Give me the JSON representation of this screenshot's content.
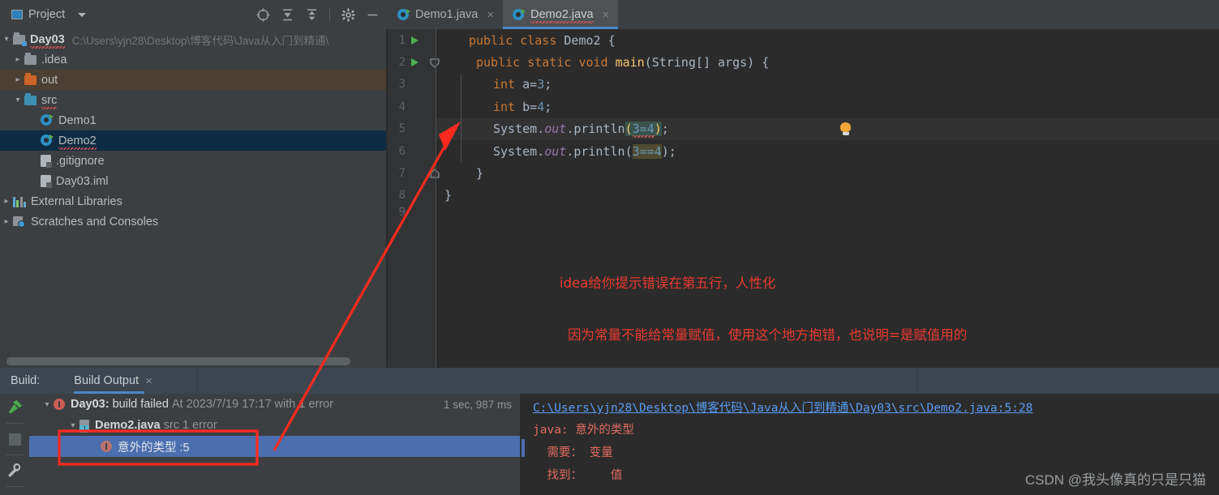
{
  "project_panel": {
    "title": "Project",
    "icons": [
      "window-icon",
      "chevron-down-icon",
      "locate-target-icon",
      "expand-all-icon",
      "collapse-all-icon",
      "gear-icon",
      "minimize-icon"
    ],
    "tree": [
      {
        "label": "Day03",
        "path": "C:\\Users\\yjn28\\Desktop\\博客代码\\Java从入门到精通\\",
        "icon": "folder-module-icon",
        "expanded": true,
        "depth": 0,
        "bold": true
      },
      {
        "label": ".idea",
        "icon": "folder-gray-icon",
        "expanded": false,
        "depth": 1
      },
      {
        "label": "out",
        "icon": "folder-orange-icon",
        "expanded": false,
        "depth": 1,
        "highlight": "excluded"
      },
      {
        "label": "src",
        "icon": "folder-blue-icon",
        "expanded": true,
        "depth": 1
      },
      {
        "label": "Demo1",
        "icon": "java-class-icon",
        "depth": 2
      },
      {
        "label": "Demo2",
        "icon": "java-class-icon",
        "depth": 2,
        "highlight": "selected"
      },
      {
        "label": ".gitignore",
        "icon": "gitignore-file-icon",
        "depth": 1
      },
      {
        "label": "Day03.iml",
        "icon": "iml-file-icon",
        "depth": 1
      },
      {
        "label": "External Libraries",
        "icon": "libraries-icon",
        "expanded": false,
        "depth": 0
      },
      {
        "label": "Scratches and Consoles",
        "icon": "scratches-icon",
        "expanded": false,
        "depth": 0
      }
    ]
  },
  "tabs": [
    {
      "label": "Demo1.java",
      "active": false,
      "icon": "java-class-icon",
      "close": "×"
    },
    {
      "label": "Demo2.java",
      "active": true,
      "icon": "java-class-icon",
      "close": "×"
    }
  ],
  "editor": {
    "line_numbers": [
      "1",
      "2",
      "3",
      "4",
      "5",
      "6",
      "7",
      "8",
      "9"
    ],
    "lines": [
      {
        "n": 1,
        "text": "public class Demo2 {"
      },
      {
        "n": 2,
        "text": "    public static void main(String[] args) {"
      },
      {
        "n": 3,
        "text": "        int a=3;"
      },
      {
        "n": 4,
        "text": "        int b=4;"
      },
      {
        "n": 5,
        "text": "        System.out.println(3=4);",
        "current": true,
        "bulb": true
      },
      {
        "n": 6,
        "text": "        System.out.println(3==4);"
      },
      {
        "n": 7,
        "text": "    }"
      },
      {
        "n": 8,
        "text": "}"
      }
    ],
    "tokens": {
      "l1_kw1": "public",
      "l1_kw2": "class",
      "l1_name": "Demo2 {",
      "l2_kw1": "public",
      "l2_kw2": "static",
      "l2_kw3": "void",
      "l2_mth": "main",
      "l2_rest": "(String[] args) {",
      "l3_kw": "int",
      "l3_var": " a=",
      "l3_num": "3",
      "l3_semi": ";",
      "l4_kw": "int",
      "l4_var": " b=",
      "l4_num": "4",
      "l4_semi": ";",
      "l5_sys": "System.",
      "l5_out": "out",
      "l5_dot": ".",
      "l5_mth": "println",
      "l5_op": "(",
      "l5_a": "3=4",
      "l5_cp": ")",
      "l5_semi": ";",
      "l6_sys": "System.",
      "l6_out": "out",
      "l6_dot": ".",
      "l6_mth": "println",
      "l6_op": "(",
      "l6_a": "3==4",
      "l6_cp": ")",
      "l6_semi": ";",
      "l7_brace": "}",
      "l8_brace": "}"
    }
  },
  "annotations": [
    {
      "text": "idea给你提示错误在第五行，人性化",
      "color": "#e93a2e"
    },
    {
      "text": "因为常量不能给常量赋值，使用这个地方抱错，也说明=是赋值用的",
      "color": "#e93a2e"
    }
  ],
  "build": {
    "panel_label": "Build:",
    "tab_label": "Build Output",
    "tab_close": "×",
    "side_icons": [
      "build-hammer-icon",
      "stop-icon",
      "wrench-icon"
    ],
    "rows": [
      {
        "title_bold": "Day03:",
        "title": "build failed",
        "detail": "At 2023/7/19 17:17 with 1 error",
        "duration": "1 sec, 987 ms",
        "icon": "error-icon",
        "expanded": true,
        "depth": 0
      },
      {
        "title": "Demo2.java",
        "detail": "src 1 error",
        "icon": "java-file-icon",
        "expanded": true,
        "depth": 1
      },
      {
        "title": "意外的类型 :5",
        "icon": "error-icon",
        "depth": 2,
        "selected": true
      }
    ],
    "error_detail": {
      "link": "C:\\Users\\yjn28\\Desktop\\博客代码\\Java从入门到精通\\Day03\\src\\Demo2.java:5:28",
      "lines": [
        "java: 意外的类型",
        "  需要： 变量",
        "  找到：    值"
      ]
    }
  },
  "watermark": "CSDN @我头像真的只是只猫",
  "colors": {
    "accent_blue": "#4a88c7",
    "error_red": "#cf5b56",
    "annotation_red": "#e93a2e",
    "selection_blue": "#4b6eaf",
    "tree_selection": "#0d2c43",
    "excluded_folder": "#4b4031",
    "editor_bg": "#2b2b2b",
    "panel_bg": "#3c3f41"
  }
}
